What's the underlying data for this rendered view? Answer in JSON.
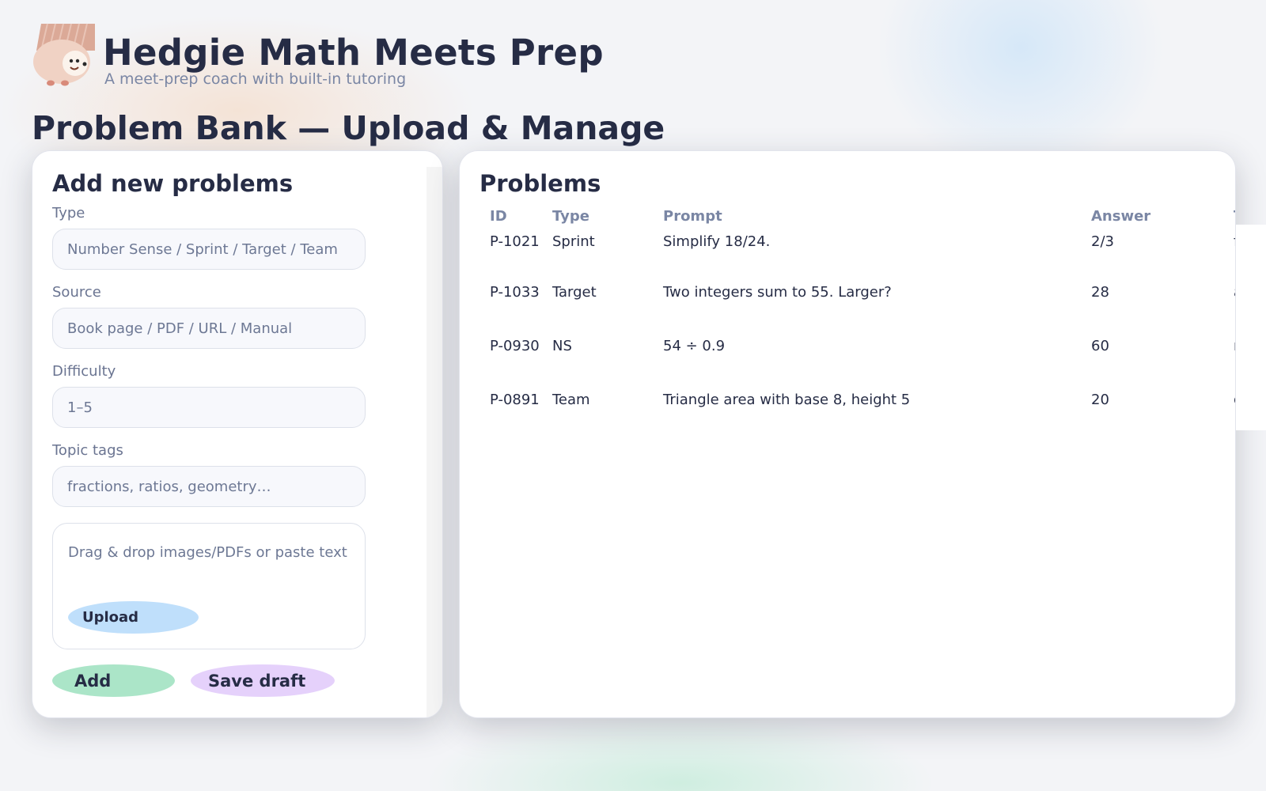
{
  "app": {
    "title": "Hedgie Math Meets Prep",
    "subtitle": "A meet-prep coach with built-in tutoring",
    "logo_icon": "hedgehog-icon"
  },
  "page": {
    "title": "Problem Bank — Upload & Manage"
  },
  "add_form": {
    "title": "Add new problems",
    "fields": [
      {
        "label": "Type",
        "placeholder": "Number Sense / Sprint / Target / Team",
        "value": ""
      },
      {
        "label": "Source",
        "placeholder": "Book page / PDF / URL / Manual",
        "value": ""
      },
      {
        "label": "Difficulty",
        "placeholder": "1–5",
        "value": ""
      },
      {
        "label": "Topic tags",
        "placeholder": "fractions, ratios, geometry…",
        "value": ""
      }
    ],
    "dropzone": {
      "text": "Drag & drop images/PDFs or paste text",
      "upload_label": "Upload"
    },
    "add_label": "Add",
    "save_draft_label": "Save draft"
  },
  "problems": {
    "title": "Problems",
    "columns": [
      "ID",
      "Type",
      "Prompt",
      "Answer",
      "Tags"
    ],
    "rows": [
      {
        "id": "P-1021",
        "type": "Sprint",
        "prompt": "Simplify 18/24.",
        "answer": "2/3",
        "tags": "fract"
      },
      {
        "id": "P-1033",
        "type": "Target",
        "prompt": "Two integers sum to 55. Larger?",
        "answer": "28",
        "tags": "algeb"
      },
      {
        "id": "P-0930",
        "type": "NS",
        "prompt": "54 ÷ 0.9",
        "answer": "60",
        "tags": "ment"
      },
      {
        "id": "P-0891",
        "type": "Team",
        "prompt": "Triangle area with base 8, height 5",
        "answer": "20",
        "tags": "geon"
      }
    ]
  },
  "colors": {
    "text_primary": "#262c45",
    "text_muted": "#7a86a4",
    "upload_button": "#bfdffb",
    "add_button": "#abe5c8",
    "save_draft_button": "#e5d1fb"
  }
}
